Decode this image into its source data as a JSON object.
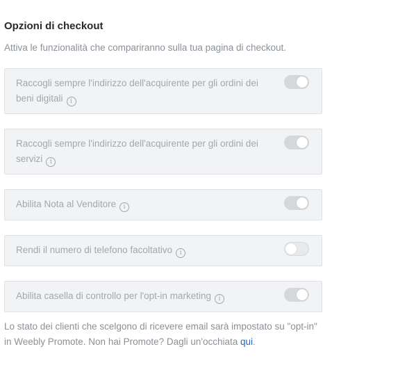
{
  "section": {
    "title": "Opzioni di checkout",
    "subtitle": "Attiva le funzionalità che compariranno sulla tua pagina di checkout."
  },
  "options": [
    {
      "label": "Raccogli sempre l'indirizzo dell'acquirente per gli ordini dei beni digitali",
      "info_icon": "i",
      "toggle": "on"
    },
    {
      "label": "Raccogli sempre l'indirizzo dell'acquirente per gli ordini dei servizi",
      "info_icon": "i",
      "toggle": "on"
    },
    {
      "label": "Abilita Nota al Venditore",
      "info_icon": "i",
      "toggle": "on"
    },
    {
      "label": "Rendi il numero di telefono facoltativo",
      "info_icon": "i",
      "toggle": "off"
    },
    {
      "label": "Abilita casella di controllo per l'opt-in marketing",
      "info_icon": "i",
      "toggle": "on"
    }
  ],
  "footnote": {
    "text": "Lo stato dei clienti che scelgono di ricevere email sarà impostato su \"opt-in\" in Weebly Promote. Non hai Promote? Dagli un'occhiata ",
    "link_label": "qui",
    "end": "."
  },
  "colors": {
    "link": "#2264c8",
    "card_background": "#f2f3f5",
    "muted_text": "#a2a7ad"
  }
}
